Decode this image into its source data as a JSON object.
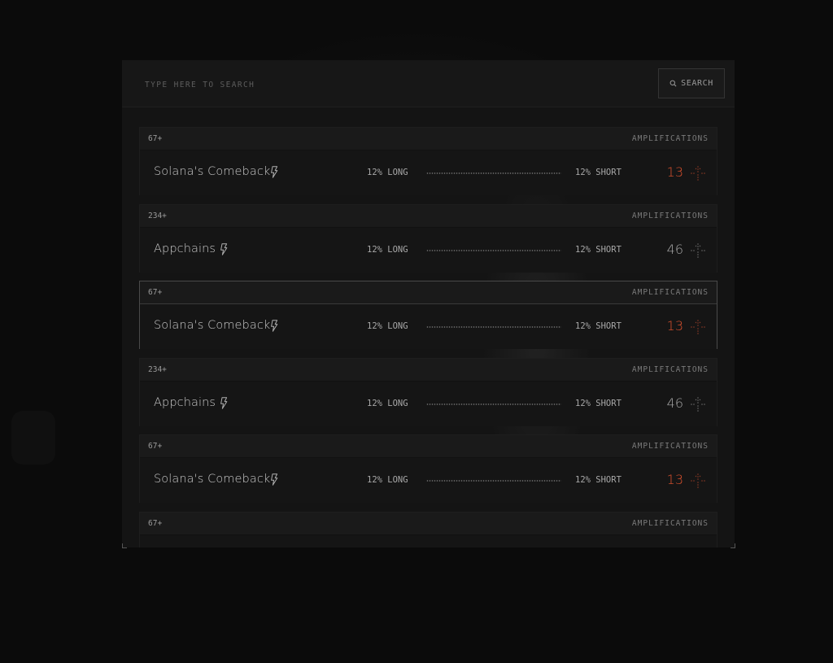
{
  "search": {
    "placeholder": "TYPE HERE TO SEARCH",
    "button_label": "SEARCH",
    "button_icon": "search-icon"
  },
  "colors": {
    "accent_orange": "#e0522e",
    "neutral_score": "#a8a8a8"
  },
  "cards": [
    {
      "count": "67+",
      "amp_label": "AMPLIFICATIONS",
      "title": "Solana's Comeback",
      "long": "12% LONG",
      "short": "12% SHORT",
      "score": "13",
      "score_color": "#e0522e",
      "icon": "lightning-icon",
      "amp_icon": "amplify-arrow-icon",
      "selected": false
    },
    {
      "count": "234+",
      "amp_label": "AMPLIFICATIONS",
      "title": "Appchains",
      "long": "12% LONG",
      "short": "12% SHORT",
      "score": "46",
      "score_color": "#a8a8a8",
      "icon": "lightning-icon",
      "amp_icon": "amplify-arrow-icon",
      "selected": false
    },
    {
      "count": "67+",
      "amp_label": "AMPLIFICATIONS",
      "title": "Solana's Comeback",
      "long": "12% LONG",
      "short": "12% SHORT",
      "score": "13",
      "score_color": "#e0522e",
      "icon": "lightning-icon",
      "amp_icon": "amplify-arrow-icon",
      "selected": true
    },
    {
      "count": "234+",
      "amp_label": "AMPLIFICATIONS",
      "title": "Appchains",
      "long": "12% LONG",
      "short": "12% SHORT",
      "score": "46",
      "score_color": "#a8a8a8",
      "icon": "lightning-icon",
      "amp_icon": "amplify-arrow-icon",
      "selected": false
    },
    {
      "count": "67+",
      "amp_label": "AMPLIFICATIONS",
      "title": "Solana's Comeback",
      "long": "12% LONG",
      "short": "12% SHORT",
      "score": "13",
      "score_color": "#e0522e",
      "icon": "lightning-icon",
      "amp_icon": "amplify-arrow-icon",
      "selected": false
    },
    {
      "count": "67+",
      "amp_label": "AMPLIFICATIONS",
      "title": "",
      "long": "",
      "short": "",
      "score": "",
      "score_color": "#e0522e",
      "icon": "",
      "amp_icon": "",
      "selected": false
    }
  ]
}
